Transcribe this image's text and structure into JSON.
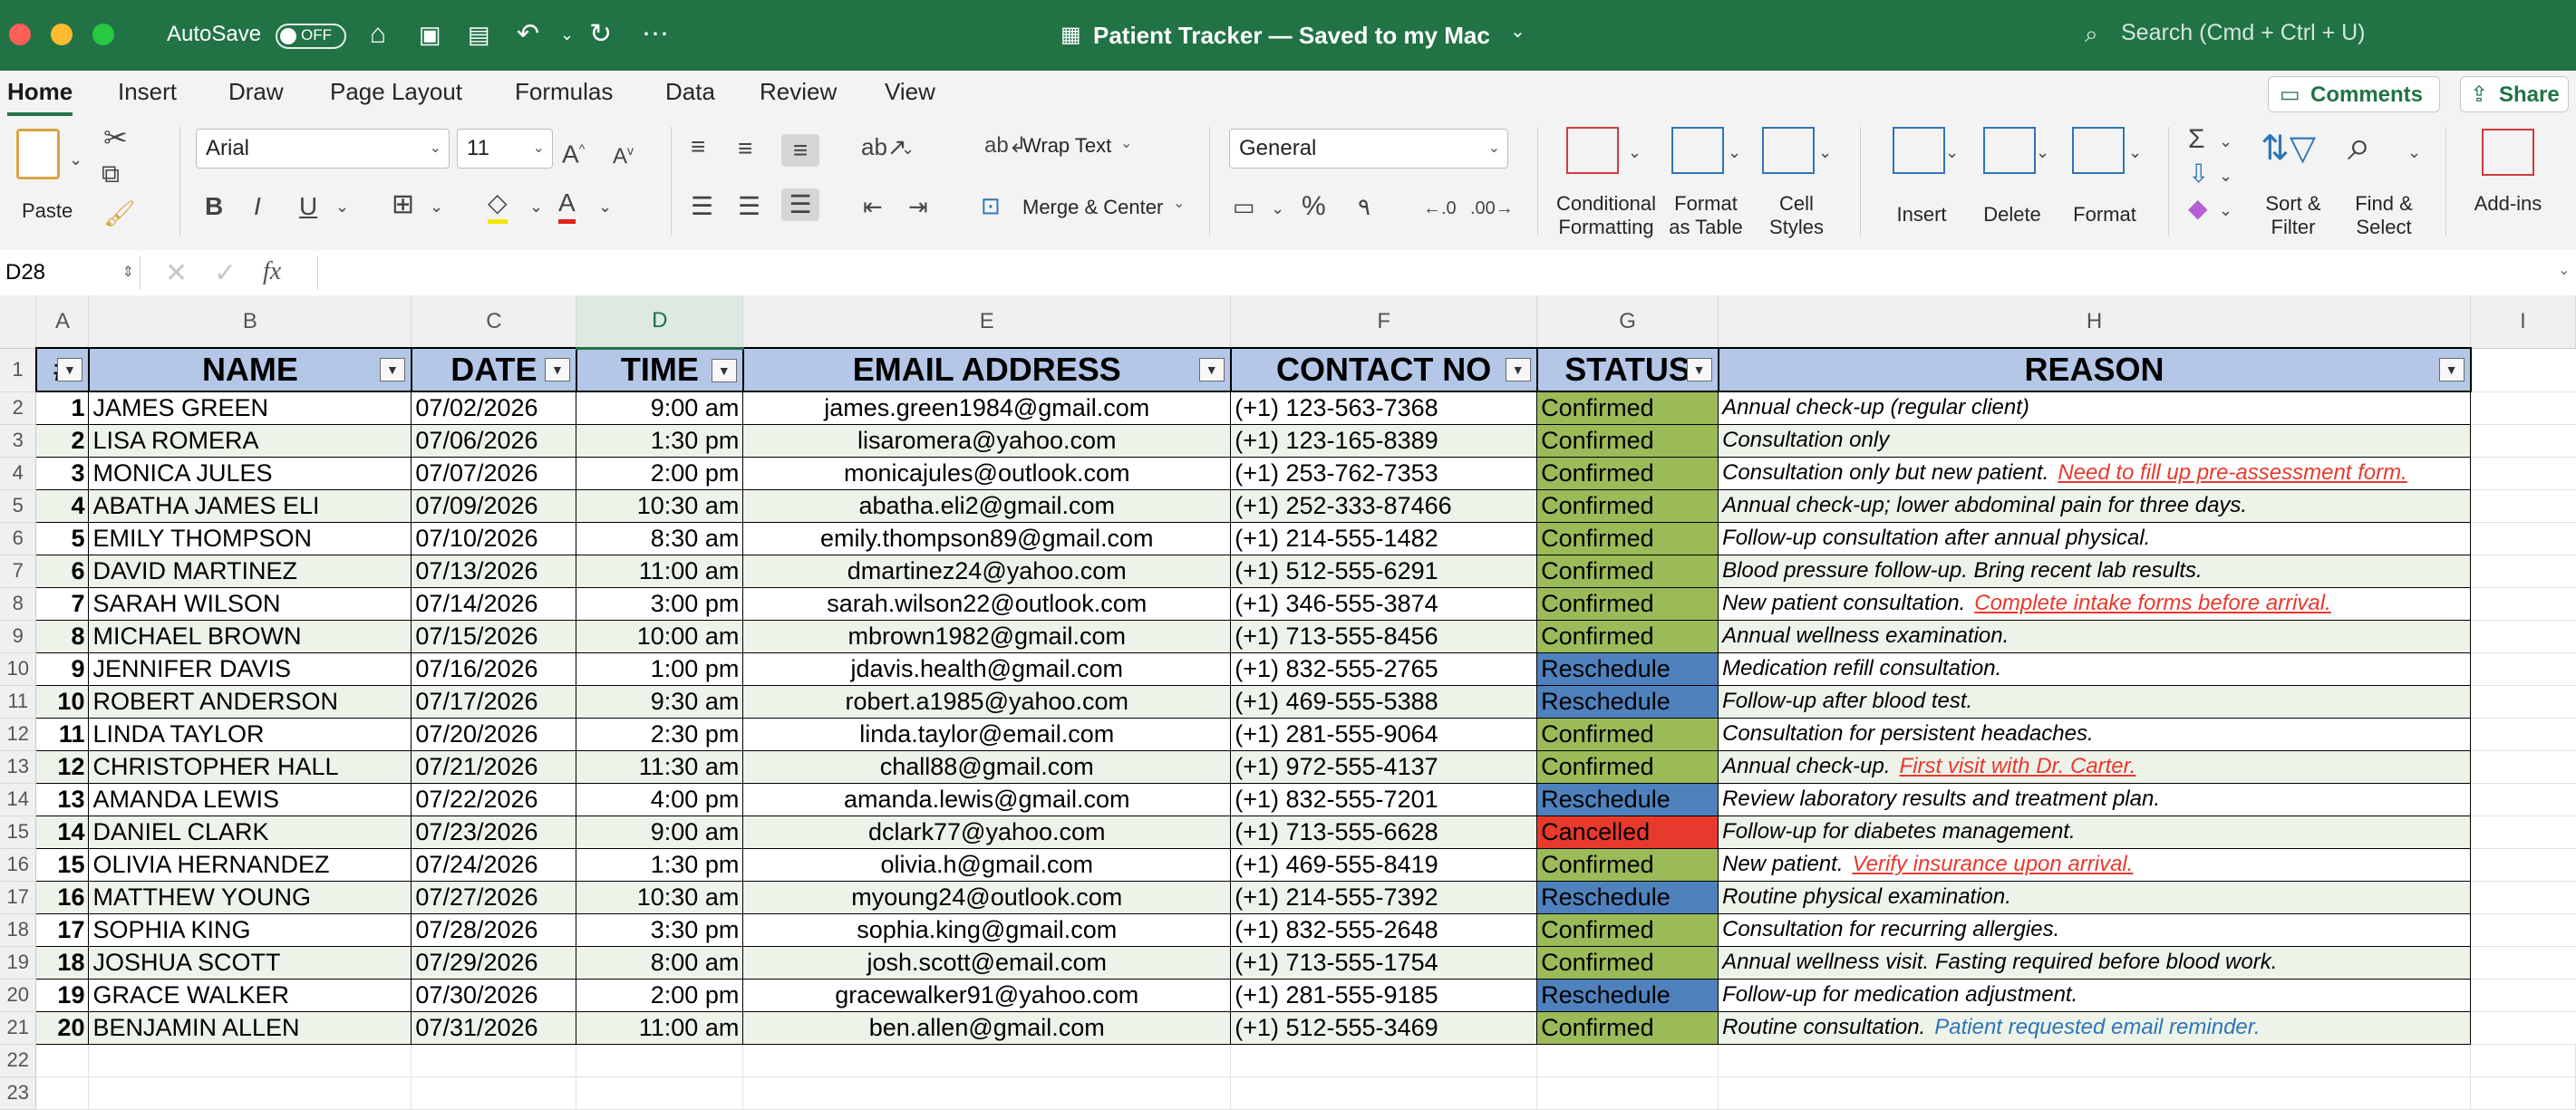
{
  "window": {
    "title": "Patient Tracker — Saved to my Mac",
    "autosave_label": "AutoSave",
    "autosave_state": "OFF",
    "search_placeholder": "Search (Cmd + Ctrl + U)"
  },
  "menu_tabs": [
    "Home",
    "Insert",
    "Draw",
    "Page Layout",
    "Formulas",
    "Data",
    "Review",
    "View"
  ],
  "active_tab": "Home",
  "top_buttons": {
    "comments": "Comments",
    "share": "Share"
  },
  "ribbon": {
    "paste": "Paste",
    "font_name": "Arial",
    "font_size": "11",
    "wrap_text": "Wrap Text",
    "merge_center": "Merge & Center",
    "number_format": "General",
    "conditional_formatting": [
      "Conditional",
      "Formatting"
    ],
    "format_as_table": [
      "Format",
      "as Table"
    ],
    "cell_styles": [
      "Cell",
      "Styles"
    ],
    "insert": "Insert",
    "delete": "Delete",
    "format": "Format",
    "sort_filter": [
      "Sort &",
      "Filter"
    ],
    "find_select": [
      "Find &",
      "Select"
    ],
    "add_ins": "Add-ins",
    "bold": "B",
    "italic": "I",
    "underline": "U",
    "percent": "%",
    "comma": "٩"
  },
  "formula_bar": {
    "name_box": "D28",
    "fx": "fx",
    "content": ""
  },
  "columns": [
    "A",
    "B",
    "C",
    "D",
    "E",
    "F",
    "G",
    "H",
    "I"
  ],
  "selected_column": "D",
  "row_numbers": [
    "1",
    "2",
    "3",
    "4",
    "5",
    "6",
    "7",
    "8",
    "9",
    "10",
    "11",
    "12",
    "13",
    "14",
    "15",
    "16",
    "17",
    "18",
    "19",
    "20",
    "21",
    "22",
    "23"
  ],
  "headers": [
    "#",
    "NAME",
    "DATE",
    "TIME",
    "EMAIL ADDRESS",
    "CONTACT NO",
    "STATUS",
    "REASON"
  ],
  "status_colors": {
    "Confirmed": "#9bbb59",
    "Reschedule": "#4f81bd",
    "Cancelled": "#e8392d"
  },
  "note_colors": {
    "red": "#e8392d",
    "blue": "#2e75b6"
  },
  "rows": [
    {
      "no": "1",
      "name": "JAMES GREEN",
      "date": "07/02/2026",
      "time": "9:00 am",
      "email": "james.green1984@gmail.com",
      "contact": "(+1) 123-563-7368",
      "status": "Confirmed",
      "reason": "Annual check-up (regular client)",
      "note": "",
      "note_color": ""
    },
    {
      "no": "2",
      "name": "LISA ROMERA",
      "date": "07/06/2026",
      "time": "1:30 pm",
      "email": "lisaromera@yahoo.com",
      "contact": "(+1) 123-165-8389",
      "status": "Confirmed",
      "reason": "Consultation only",
      "note": "",
      "note_color": ""
    },
    {
      "no": "3",
      "name": "MONICA JULES",
      "date": "07/07/2026",
      "time": "2:00 pm",
      "email": "monicajules@outlook.com",
      "contact": "(+1) 253-762-7353",
      "status": "Confirmed",
      "reason": "Consultation only but new patient.",
      "note": "Need to fill up pre-assessment form.",
      "note_color": "red"
    },
    {
      "no": "4",
      "name": "ABATHA JAMES ELI",
      "date": "07/09/2026",
      "time": "10:30 am",
      "email": "abatha.eli2@gmail.com",
      "contact": "(+1) 252-333-87466",
      "status": "Confirmed",
      "reason": "Annual check-up; lower abdominal pain for three days.",
      "note": "",
      "note_color": ""
    },
    {
      "no": "5",
      "name": "EMILY THOMPSON",
      "date": "07/10/2026",
      "time": "8:30 am",
      "email": "emily.thompson89@gmail.com",
      "contact": "(+1) 214-555-1482",
      "status": "Confirmed",
      "reason": "Follow-up consultation after annual physical.",
      "note": "",
      "note_color": ""
    },
    {
      "no": "6",
      "name": "DAVID MARTINEZ",
      "date": "07/13/2026",
      "time": "11:00 am",
      "email": "dmartinez24@yahoo.com",
      "contact": "(+1) 512-555-6291",
      "status": "Confirmed",
      "reason": "Blood pressure follow-up. Bring recent lab results.",
      "note": "",
      "note_color": ""
    },
    {
      "no": "7",
      "name": "SARAH WILSON",
      "date": "07/14/2026",
      "time": "3:00 pm",
      "email": "sarah.wilson22@outlook.com",
      "contact": "(+1) 346-555-3874",
      "status": "Confirmed",
      "reason": "New patient consultation.",
      "note": "Complete intake forms before arrival.",
      "note_color": "red"
    },
    {
      "no": "8",
      "name": "MICHAEL BROWN",
      "date": "07/15/2026",
      "time": "10:00 am",
      "email": "mbrown1982@gmail.com",
      "contact": "(+1) 713-555-8456",
      "status": "Confirmed",
      "reason": "Annual wellness examination.",
      "note": "",
      "note_color": ""
    },
    {
      "no": "9",
      "name": "JENNIFER DAVIS",
      "date": "07/16/2026",
      "time": "1:00 pm",
      "email": "jdavis.health@gmail.com",
      "contact": "(+1) 832-555-2765",
      "status": "Reschedule",
      "reason": "Medication refill consultation.",
      "note": "",
      "note_color": ""
    },
    {
      "no": "10",
      "name": "ROBERT ANDERSON",
      "date": "07/17/2026",
      "time": "9:30 am",
      "email": "robert.a1985@yahoo.com",
      "contact": "(+1) 469-555-5388",
      "status": "Reschedule",
      "reason": "Follow-up after blood test.",
      "note": "",
      "note_color": ""
    },
    {
      "no": "11",
      "name": "LINDA TAYLOR",
      "date": "07/20/2026",
      "time": "2:30 pm",
      "email": "linda.taylor@email.com",
      "contact": "(+1) 281-555-9064",
      "status": "Confirmed",
      "reason": "Consultation for persistent headaches.",
      "note": "",
      "note_color": ""
    },
    {
      "no": "12",
      "name": "CHRISTOPHER HALL",
      "date": "07/21/2026",
      "time": "11:30 am",
      "email": "chall88@gmail.com",
      "contact": "(+1) 972-555-4137",
      "status": "Confirmed",
      "reason": "Annual check-up.",
      "note": "First visit with Dr. Carter.",
      "note_color": "red"
    },
    {
      "no": "13",
      "name": "AMANDA LEWIS",
      "date": "07/22/2026",
      "time": "4:00 pm",
      "email": "amanda.lewis@gmail.com",
      "contact": "(+1) 832-555-7201",
      "status": "Reschedule",
      "reason": "Review laboratory results and treatment plan.",
      "note": "",
      "note_color": ""
    },
    {
      "no": "14",
      "name": "DANIEL CLARK",
      "date": "07/23/2026",
      "time": "9:00 am",
      "email": "dclark77@yahoo.com",
      "contact": "(+1) 713-555-6628",
      "status": "Cancelled",
      "reason": "Follow-up for diabetes management.",
      "note": "",
      "note_color": ""
    },
    {
      "no": "15",
      "name": "OLIVIA HERNANDEZ",
      "date": "07/24/2026",
      "time": "1:30 pm",
      "email": "olivia.h@gmail.com",
      "contact": "(+1) 469-555-8419",
      "status": "Confirmed",
      "reason": "New patient.",
      "note": "Verify insurance upon arrival.",
      "note_color": "red"
    },
    {
      "no": "16",
      "name": "MATTHEW YOUNG",
      "date": "07/27/2026",
      "time": "10:30 am",
      "email": "myoung24@outlook.com",
      "contact": "(+1) 214-555-7392",
      "status": "Reschedule",
      "reason": "Routine physical examination.",
      "note": "",
      "note_color": ""
    },
    {
      "no": "17",
      "name": "SOPHIA KING",
      "date": "07/28/2026",
      "time": "3:30 pm",
      "email": "sophia.king@gmail.com",
      "contact": "(+1) 832-555-2648",
      "status": "Confirmed",
      "reason": "Consultation for recurring allergies.",
      "note": "",
      "note_color": ""
    },
    {
      "no": "18",
      "name": "JOSHUA SCOTT",
      "date": "07/29/2026",
      "time": "8:00 am",
      "email": "josh.scott@email.com",
      "contact": "(+1) 713-555-1754",
      "status": "Confirmed",
      "reason": "Annual wellness visit. Fasting required before blood work.",
      "note": "",
      "note_color": ""
    },
    {
      "no": "19",
      "name": "GRACE WALKER",
      "date": "07/30/2026",
      "time": "2:00 pm",
      "email": "gracewalker91@yahoo.com",
      "contact": "(+1) 281-555-9185",
      "status": "Reschedule",
      "reason": "Follow-up for medication adjustment.",
      "note": "",
      "note_color": ""
    },
    {
      "no": "20",
      "name": "BENJAMIN ALLEN",
      "date": "07/31/2026",
      "time": "11:00 am",
      "email": "ben.allen@gmail.com",
      "contact": "(+1) 512-555-3469",
      "status": "Confirmed",
      "reason": "Routine consultation.",
      "note": "Patient requested email reminder.",
      "note_color": "blue"
    }
  ]
}
